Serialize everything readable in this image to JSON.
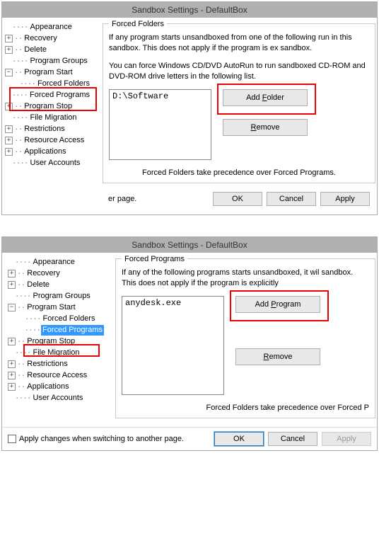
{
  "windowTitle": "Sandbox Settings - DefaultBox",
  "tree": {
    "appearance": "Appearance",
    "recovery": "Recovery",
    "delete": "Delete",
    "programGroups": "Program Groups",
    "programStart": "Program Start",
    "forcedFolders": "Forced Folders",
    "forcedPrograms": "Forced Programs",
    "programStop": "Program Stop",
    "fileMigration": "File Migration",
    "restrictions": "Restrictions",
    "resourceAccess": "Resource Access",
    "applications": "Applications",
    "userAccounts": "User Accounts"
  },
  "top": {
    "group": "Forced Folders",
    "desc1": "If any program starts unsandboxed from one of the following run in this sandbox.  This does not apply if the program is ex sandbox.",
    "desc2": "You can force Windows CD/DVD AutoRun to run sandboxed CD-ROM and DVD-ROM drive letters in the following list.",
    "listItems": [
      "D:\\Software"
    ],
    "addBtnPrefix": "Add ",
    "addBtnKey": "F",
    "addBtnSuffix": "older",
    "removeBtnPrefix": "",
    "removeBtnKey": "R",
    "removeBtnSuffix": "emove",
    "note": "Forced Folders take precedence over Forced Programs.",
    "leftFooter": "er page.",
    "ok": "OK",
    "cancel": "Cancel",
    "apply": "Apply"
  },
  "bottom": {
    "group": "Forced Programs",
    "desc1": "If any of the following programs starts unsandboxed, it wil sandbox.  This does not apply if the program is explicitly ",
    "listItems": [
      "anydesk.exe"
    ],
    "addBtnPrefix": "Add ",
    "addBtnKey": "P",
    "addBtnSuffix": "rogram",
    "removeBtnPrefix": "",
    "removeBtnKey": "R",
    "removeBtnSuffix": "emove",
    "note": "Forced Folders take precedence over Forced P",
    "checkbox": "Apply changes when switching to another page.",
    "ok": "OK",
    "cancel": "Cancel",
    "apply": "Apply"
  }
}
